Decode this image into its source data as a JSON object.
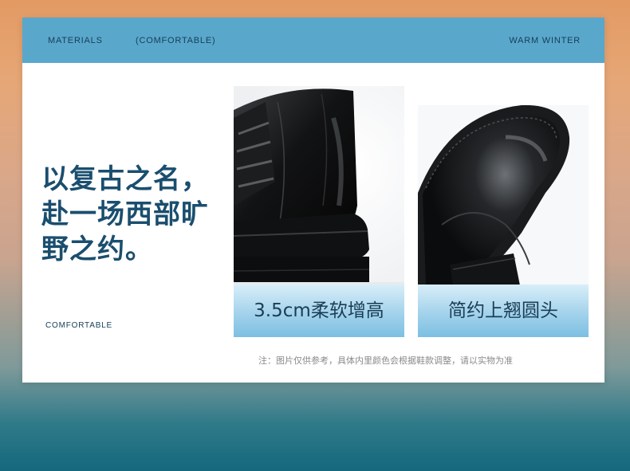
{
  "header": {
    "left": "MATERIALS",
    "middle": "(COMFORTABLE)",
    "right": "WARM WINTER"
  },
  "headline": {
    "line1": "以复古之名，",
    "line2": "赴一场西部旷",
    "line3": "野之约。"
  },
  "tagline": "COMFORTABLE",
  "features": [
    {
      "label": "3.5cm柔软增高"
    },
    {
      "label": "简约上翘圆头"
    }
  ],
  "footnote": "注：图片仅供参考，具体内里颜色会根据鞋款调整，请以实物为准",
  "colors": {
    "header_bar": "#5aa7cc",
    "headline_text": "#1a4e6e",
    "label_gradient_top": "#d8eef9",
    "label_gradient_bottom": "#7cbfe2"
  }
}
